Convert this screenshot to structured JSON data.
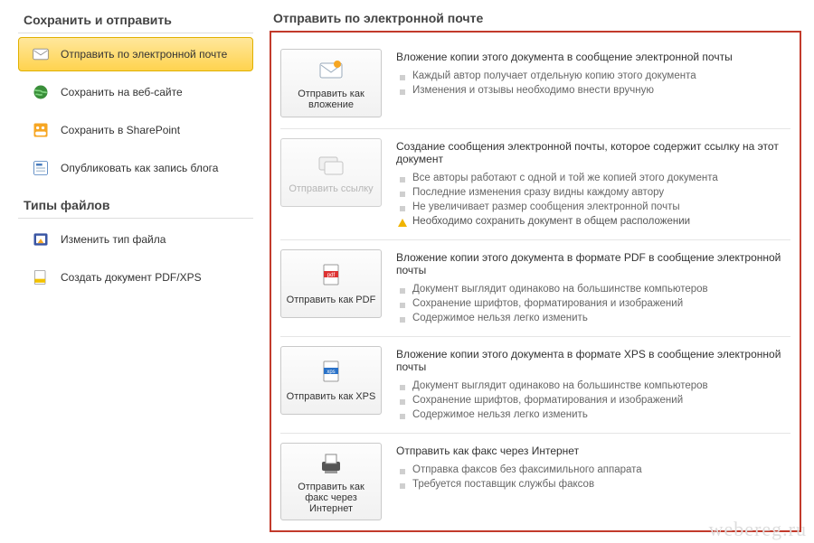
{
  "sidebar": {
    "heading1": "Сохранить и отправить",
    "items1": [
      {
        "label": "Отправить по электронной почте"
      },
      {
        "label": "Сохранить на веб-сайте"
      },
      {
        "label": "Сохранить в SharePoint"
      },
      {
        "label": "Опубликовать как запись блога"
      }
    ],
    "heading2": "Типы файлов",
    "items2": [
      {
        "label": "Изменить тип файла"
      },
      {
        "label": "Создать документ PDF/XPS"
      }
    ]
  },
  "content": {
    "heading": "Отправить по электронной почте",
    "options": [
      {
        "button": "Отправить как вложение",
        "title": "Вложение копии этого документа в сообщение электронной почты",
        "bullets": [
          "Каждый автор получает отдельную копию этого документа",
          "Изменения и отзывы необходимо внести вручную"
        ]
      },
      {
        "button": "Отправить ссылку",
        "disabled": true,
        "title": "Создание сообщения электронной почты, которое содержит ссылку на этот документ",
        "bullets": [
          "Все авторы работают с одной и той же копией этого документа",
          "Последние изменения сразу видны каждому автору",
          "Не увеличивает размер сообщения электронной почты"
        ],
        "warning": "Необходимо сохранить документ в общем расположении"
      },
      {
        "button": "Отправить как PDF",
        "title": "Вложение копии этого документа в формате PDF в сообщение электронной почты",
        "bullets": [
          "Документ выглядит одинаково на большинстве компьютеров",
          "Сохранение шрифтов, форматирования и изображений",
          "Содержимое нельзя легко изменить"
        ]
      },
      {
        "button": "Отправить как XPS",
        "title": "Вложение копии этого документа в формате XPS в сообщение электронной почты",
        "bullets": [
          "Документ выглядит одинаково на большинстве компьютеров",
          "Сохранение шрифтов, форматирования и изображений",
          "Содержимое нельзя легко изменить"
        ]
      },
      {
        "button": "Отправить как факс через Интернет",
        "title": "Отправить как факс через Интернет",
        "bullets": [
          "Отправка факсов без факсимильного аппарата",
          "Требуется поставщик службы факсов"
        ]
      }
    ]
  },
  "watermark": "webereg.ru"
}
